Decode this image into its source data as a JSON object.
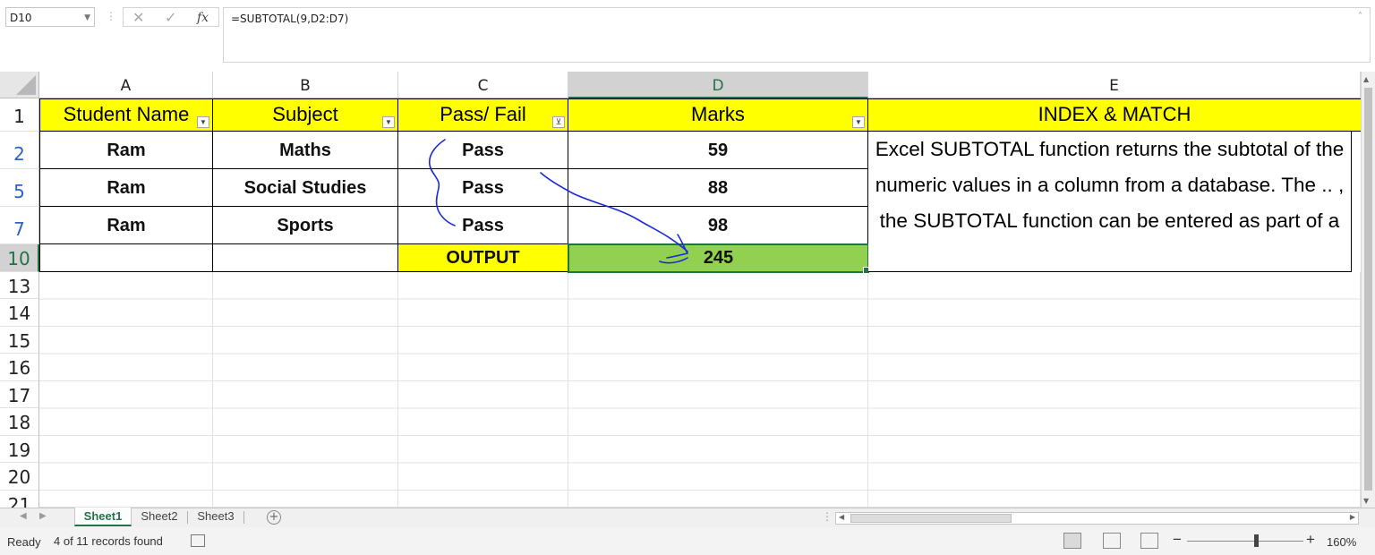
{
  "formula_bar": {
    "name_box": "D10",
    "cancel_icon": "✕",
    "enter_icon": "✓",
    "fx_label": "fx",
    "formula": "=SUBTOTAL(9,D2:D7)"
  },
  "columns": [
    "A",
    "B",
    "C",
    "D",
    "E"
  ],
  "selected_column": "D",
  "rows": [
    "1",
    "2",
    "5",
    "7",
    "10",
    "13",
    "14",
    "15",
    "16",
    "17",
    "18",
    "19",
    "20",
    "21"
  ],
  "selected_row": "10",
  "header_row": {
    "a": "Student Name",
    "b": "Subject",
    "c": "Pass/ Fail",
    "d": "Marks",
    "e": "INDEX & MATCH"
  },
  "data_rows": [
    {
      "a": "Ram",
      "b": "Maths",
      "c": "Pass",
      "d": "59"
    },
    {
      "a": "Ram",
      "b": "Social Studies",
      "c": "Pass",
      "d": "88"
    },
    {
      "a": "Ram",
      "b": "Sports",
      "c": "Pass",
      "d": "98"
    }
  ],
  "output_row": {
    "c": "OUTPUT",
    "d": "245"
  },
  "description": "Excel SUBTOTAL function returns the subtotal of the numeric values in a column from a database. The .. , the SUBTOTAL function can be entered as part of a",
  "sheets": [
    "Sheet1",
    "Sheet2",
    "Sheet3"
  ],
  "active_sheet": "Sheet1",
  "status": {
    "ready": "Ready",
    "records": "4 of 11 records found",
    "zoom": "160%"
  },
  "colors": {
    "header_fill": "#ffff00",
    "output_fill": "#92d050",
    "accent": "#217346",
    "ink": "#1a2bd9"
  }
}
